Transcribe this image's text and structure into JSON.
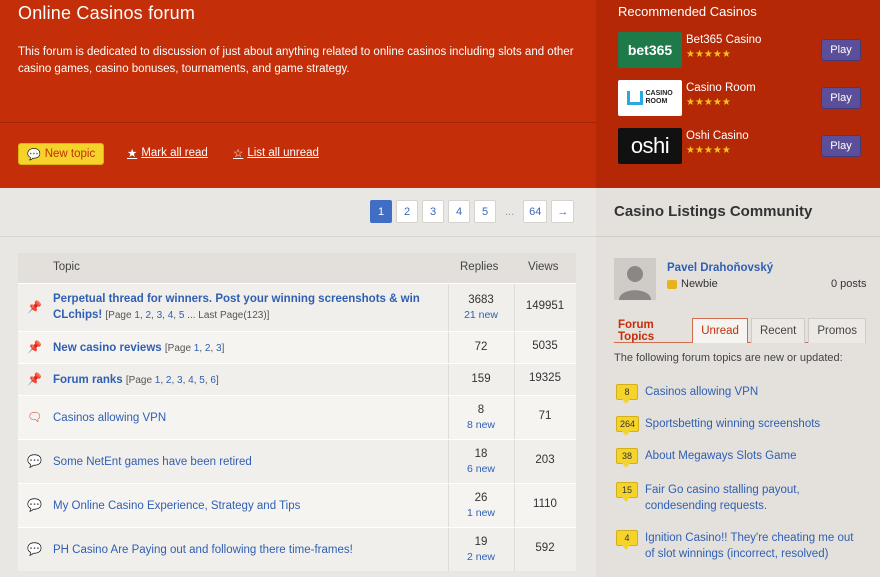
{
  "forum": {
    "title": "Online Casinos forum",
    "description": "This forum is dedicated to discussion of just about anything related to online casinos including slots and other casino games, casino bonuses, tournaments, and game strategy.",
    "new_topic_label": "New topic",
    "mark_all_read_label": "Mark all read",
    "list_all_unread_label": "List all unread"
  },
  "recommended": {
    "title": "Recommended Casinos",
    "casinos": [
      {
        "name": "Bet365 Casino",
        "logo_text": "bet365",
        "stars": "★★★★★",
        "play_label": "Play"
      },
      {
        "name": "Casino Room",
        "logo_text": "CASINO ROOM",
        "stars": "★★★★★",
        "play_label": "Play"
      },
      {
        "name": "Oshi Casino",
        "logo_text": "oshi",
        "stars": "★★★★★",
        "play_label": "Play"
      }
    ]
  },
  "pagination": {
    "pages": [
      "1",
      "2",
      "3",
      "4",
      "5"
    ],
    "ellipsis": "...",
    "last": "64",
    "next": "→",
    "current": "1"
  },
  "table": {
    "headers": {
      "topic": "Topic",
      "replies": "Replies",
      "views": "Views"
    },
    "rows": [
      {
        "icon": "pin-icon",
        "title_line1": "Perpetual thread for winners. Post your winning screenshots & win",
        "title_line2": "CLchips!",
        "pages": [
          "1",
          "2",
          "3",
          "4",
          "5"
        ],
        "pages_prefix": "[Page ",
        "pages_suffix": " ... Last Page(123)]",
        "replies": "3683",
        "new": "21 new",
        "views": "149951"
      },
      {
        "icon": "pin-icon",
        "title_line1": "New casino reviews",
        "pages": [
          "1",
          "2",
          "3"
        ],
        "pages_prefix": "[Page ",
        "pages_suffix": "]",
        "replies": "72",
        "new": "",
        "views": "5035"
      },
      {
        "icon": "pin-icon",
        "title_line1": "Forum ranks",
        "pages": [
          "1",
          "2",
          "3",
          "4",
          "5",
          "6"
        ],
        "pages_prefix": "[Page ",
        "pages_suffix": "]",
        "replies": "159",
        "new": "",
        "views": "19325"
      },
      {
        "icon": "chat-bubble-outline-icon",
        "title_line1": "Casinos allowing VPN",
        "replies": "8",
        "new": "8 new",
        "views": "71"
      },
      {
        "icon": "chat-bubble-icon",
        "title_line1": "Some NetEnt games have been retired",
        "replies": "18",
        "new": "6 new",
        "views": "203"
      },
      {
        "icon": "chat-bubble-icon",
        "title_line1": "My Online Casino Experience, Strategy and Tips",
        "replies": "26",
        "new": "1 new",
        "views": "1110"
      },
      {
        "icon": "chat-bubble-icon",
        "title_line1": "PH Casino Are Paying out and following there time-frames!",
        "replies": "19",
        "new": "2 new",
        "views": "592"
      }
    ]
  },
  "sidebar": {
    "title": "Casino Listings Community",
    "user": {
      "name": "Pavel Drahoňovský",
      "rank": "Newbie",
      "posts": "0 posts"
    },
    "tabs": [
      "Forum Topics",
      "Unread",
      "Recent",
      "Promos"
    ],
    "active_tab": "Unread",
    "note": "The following forum topics are new or updated:",
    "items": [
      {
        "count": "8",
        "title": "Casinos allowing VPN"
      },
      {
        "count": "264",
        "title": "Sportsbetting winning screenshots"
      },
      {
        "count": "38",
        "title": "About Megaways Slots Game"
      },
      {
        "count": "15",
        "title": "Fair Go casino stalling payout, condesending requests."
      },
      {
        "count": "4",
        "title": "Ignition Casino!! They're cheating me out of slot winnings (incorrect, resolved)"
      }
    ]
  },
  "colors": {
    "header_red": "#c42e08",
    "link_blue": "#2f5fb3",
    "badge_yellow": "#f5d32a",
    "play_purple": "#5a4f98"
  }
}
